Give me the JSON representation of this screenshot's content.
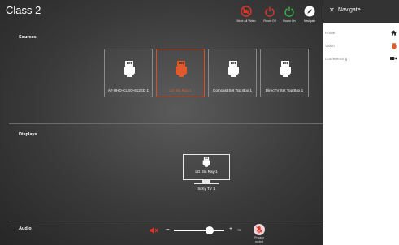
{
  "header": {
    "title": "Class 2"
  },
  "top_buttons": [
    {
      "label": "Mute All Video",
      "icon": "mute-video-icon",
      "color": "#e0342b"
    },
    {
      "label": "Room Off",
      "icon": "power-icon",
      "color": "#e0342b"
    },
    {
      "label": "Room On",
      "icon": "power-icon",
      "color": "#35b54a"
    },
    {
      "label": "Navigate",
      "icon": "compass-icon",
      "color": "#ffffff"
    }
  ],
  "sources": {
    "label": "Sources",
    "items": [
      {
        "label": "AT-UHD-CLSO-612ED 1",
        "selected": false
      },
      {
        "label": "LG Blu Ray 1",
        "selected": true
      },
      {
        "label": "Comcast Set Top Box 1",
        "selected": false
      },
      {
        "label": "DirecTV Set Top Box 1",
        "selected": false
      }
    ]
  },
  "displays": {
    "label": "Displays",
    "items": [
      {
        "name": "Sony TV 1",
        "source": "LG Blu Ray 1"
      }
    ]
  },
  "audio": {
    "label": "Audio",
    "minus": "−",
    "plus": "+",
    "volume": "70",
    "privacy_label_1": "Privacy",
    "privacy_label_2": "muted",
    "mute_color": "#e0342b"
  },
  "navigate": {
    "title": "Navigate",
    "close": "✕",
    "items": [
      {
        "label": "Home",
        "icon": "home-icon"
      },
      {
        "label": "Video",
        "icon": "hdmi-icon",
        "color": "#e05a2b"
      },
      {
        "label": "Conferencing",
        "icon": "video-camera-icon"
      }
    ]
  },
  "colors": {
    "accent": "#e05a2b",
    "panel_header": "#333333"
  }
}
